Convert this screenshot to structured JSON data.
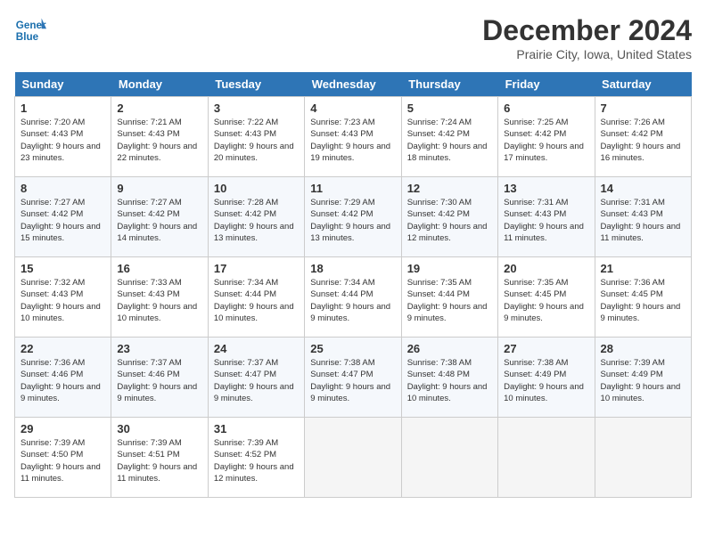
{
  "header": {
    "logo_line1": "General",
    "logo_line2": "Blue",
    "month_title": "December 2024",
    "location": "Prairie City, Iowa, United States"
  },
  "weekdays": [
    "Sunday",
    "Monday",
    "Tuesday",
    "Wednesday",
    "Thursday",
    "Friday",
    "Saturday"
  ],
  "weeks": [
    [
      {
        "day": "1",
        "sunrise": "7:20 AM",
        "sunset": "4:43 PM",
        "daylight": "9 hours and 23 minutes."
      },
      {
        "day": "2",
        "sunrise": "7:21 AM",
        "sunset": "4:43 PM",
        "daylight": "9 hours and 22 minutes."
      },
      {
        "day": "3",
        "sunrise": "7:22 AM",
        "sunset": "4:43 PM",
        "daylight": "9 hours and 20 minutes."
      },
      {
        "day": "4",
        "sunrise": "7:23 AM",
        "sunset": "4:43 PM",
        "daylight": "9 hours and 19 minutes."
      },
      {
        "day": "5",
        "sunrise": "7:24 AM",
        "sunset": "4:42 PM",
        "daylight": "9 hours and 18 minutes."
      },
      {
        "day": "6",
        "sunrise": "7:25 AM",
        "sunset": "4:42 PM",
        "daylight": "9 hours and 17 minutes."
      },
      {
        "day": "7",
        "sunrise": "7:26 AM",
        "sunset": "4:42 PM",
        "daylight": "9 hours and 16 minutes."
      }
    ],
    [
      {
        "day": "8",
        "sunrise": "7:27 AM",
        "sunset": "4:42 PM",
        "daylight": "9 hours and 15 minutes."
      },
      {
        "day": "9",
        "sunrise": "7:27 AM",
        "sunset": "4:42 PM",
        "daylight": "9 hours and 14 minutes."
      },
      {
        "day": "10",
        "sunrise": "7:28 AM",
        "sunset": "4:42 PM",
        "daylight": "9 hours and 13 minutes."
      },
      {
        "day": "11",
        "sunrise": "7:29 AM",
        "sunset": "4:42 PM",
        "daylight": "9 hours and 13 minutes."
      },
      {
        "day": "12",
        "sunrise": "7:30 AM",
        "sunset": "4:42 PM",
        "daylight": "9 hours and 12 minutes."
      },
      {
        "day": "13",
        "sunrise": "7:31 AM",
        "sunset": "4:43 PM",
        "daylight": "9 hours and 11 minutes."
      },
      {
        "day": "14",
        "sunrise": "7:31 AM",
        "sunset": "4:43 PM",
        "daylight": "9 hours and 11 minutes."
      }
    ],
    [
      {
        "day": "15",
        "sunrise": "7:32 AM",
        "sunset": "4:43 PM",
        "daylight": "9 hours and 10 minutes."
      },
      {
        "day": "16",
        "sunrise": "7:33 AM",
        "sunset": "4:43 PM",
        "daylight": "9 hours and 10 minutes."
      },
      {
        "day": "17",
        "sunrise": "7:34 AM",
        "sunset": "4:44 PM",
        "daylight": "9 hours and 10 minutes."
      },
      {
        "day": "18",
        "sunrise": "7:34 AM",
        "sunset": "4:44 PM",
        "daylight": "9 hours and 9 minutes."
      },
      {
        "day": "19",
        "sunrise": "7:35 AM",
        "sunset": "4:44 PM",
        "daylight": "9 hours and 9 minutes."
      },
      {
        "day": "20",
        "sunrise": "7:35 AM",
        "sunset": "4:45 PM",
        "daylight": "9 hours and 9 minutes."
      },
      {
        "day": "21",
        "sunrise": "7:36 AM",
        "sunset": "4:45 PM",
        "daylight": "9 hours and 9 minutes."
      }
    ],
    [
      {
        "day": "22",
        "sunrise": "7:36 AM",
        "sunset": "4:46 PM",
        "daylight": "9 hours and 9 minutes."
      },
      {
        "day": "23",
        "sunrise": "7:37 AM",
        "sunset": "4:46 PM",
        "daylight": "9 hours and 9 minutes."
      },
      {
        "day": "24",
        "sunrise": "7:37 AM",
        "sunset": "4:47 PM",
        "daylight": "9 hours and 9 minutes."
      },
      {
        "day": "25",
        "sunrise": "7:38 AM",
        "sunset": "4:47 PM",
        "daylight": "9 hours and 9 minutes."
      },
      {
        "day": "26",
        "sunrise": "7:38 AM",
        "sunset": "4:48 PM",
        "daylight": "9 hours and 10 minutes."
      },
      {
        "day": "27",
        "sunrise": "7:38 AM",
        "sunset": "4:49 PM",
        "daylight": "9 hours and 10 minutes."
      },
      {
        "day": "28",
        "sunrise": "7:39 AM",
        "sunset": "4:49 PM",
        "daylight": "9 hours and 10 minutes."
      }
    ],
    [
      {
        "day": "29",
        "sunrise": "7:39 AM",
        "sunset": "4:50 PM",
        "daylight": "9 hours and 11 minutes."
      },
      {
        "day": "30",
        "sunrise": "7:39 AM",
        "sunset": "4:51 PM",
        "daylight": "9 hours and 11 minutes."
      },
      {
        "day": "31",
        "sunrise": "7:39 AM",
        "sunset": "4:52 PM",
        "daylight": "9 hours and 12 minutes."
      },
      null,
      null,
      null,
      null
    ]
  ]
}
